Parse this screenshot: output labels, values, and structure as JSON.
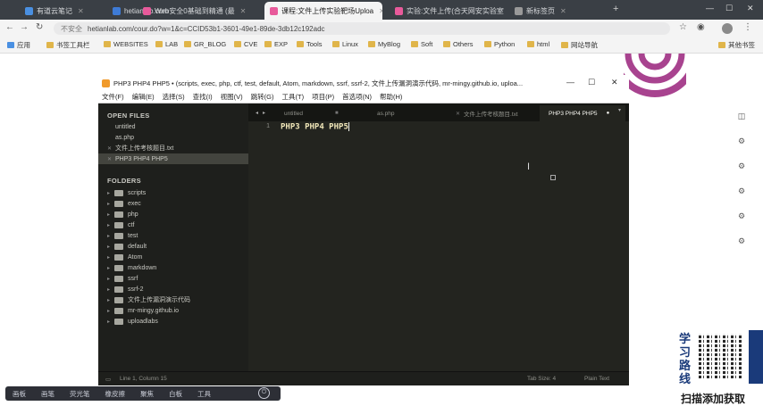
{
  "browser": {
    "tabs": [
      {
        "label": "有道云笔记",
        "color": "#4a90e2"
      },
      {
        "label": "hetianlab.com",
        "color": "#3e7bd6"
      },
      {
        "label": "Web安全0基础到精通 (最",
        "color": "#e85a9b"
      },
      {
        "label": "课程:文件上传实验靶场Uploa",
        "color": "#e85a9b"
      },
      {
        "label": "实验:文件上传(合天网安实验室",
        "color": "#e85a9b"
      },
      {
        "label": "新标签页",
        "color": "#999999"
      }
    ],
    "address": {
      "security": "不安全",
      "url": "hetianlab.com/cour.do?w=1&c=CCID53b1-3601-49e1-89de-3db12c192adc"
    },
    "bookmarks": [
      "应用",
      "书签工具栏",
      "WEBSITES",
      "LAB",
      "GR_BLOG",
      "CVE",
      "EXP",
      "Tools",
      "Linux",
      "MyBlog",
      "Soft",
      "Others",
      "Python",
      "html",
      "网站导航"
    ],
    "other_bookmarks": "其他书签"
  },
  "sublime": {
    "title": "PHP3 PHP4 PHP5 • (scripts, exec, php, ctf, test, default, Atom, markdown, ssrf, ssrf-2, 文件上传漏洞演示代码, mr-mingy.github.io, uploa...",
    "menu": [
      "文件(F)",
      "编辑(E)",
      "选择(S)",
      "查找(I)",
      "视图(V)",
      "跳转(G)",
      "工具(T)",
      "项目(P)",
      "首选项(N)",
      "帮助(H)"
    ],
    "open_files_header": "OPEN FILES",
    "open_files": [
      "untitled",
      "as.php",
      "文件上传考核题目.txt",
      "PHP3 PHP4 PHP5"
    ],
    "folders_header": "FOLDERS",
    "folders": [
      "scripts",
      "exec",
      "php",
      "ctf",
      "test",
      "default",
      "Atom",
      "markdown",
      "ssrf",
      "ssrf-2",
      "文件上传漏洞演示代码",
      "mr-mingy.github.io",
      "uploadlabs"
    ],
    "tabs": [
      "untitled",
      "as.php",
      "文件上传考核题目.txt",
      "PHP3 PHP4 PHP5"
    ],
    "line_number": "1",
    "code_line": "PHP3 PHP4 PHP5",
    "status": {
      "position": "Line 1, Column 15",
      "tab_size": "Tab Size: 4",
      "syntax": "Plain Text"
    }
  },
  "promo": {
    "vertical": [
      "学",
      "习",
      "路",
      "线"
    ],
    "bottom": "扫描添加获取"
  },
  "bottom_toolbar": [
    "画板",
    "画笔",
    "荧光笔",
    "橡皮擦",
    "聚焦",
    "白板",
    "工具"
  ]
}
